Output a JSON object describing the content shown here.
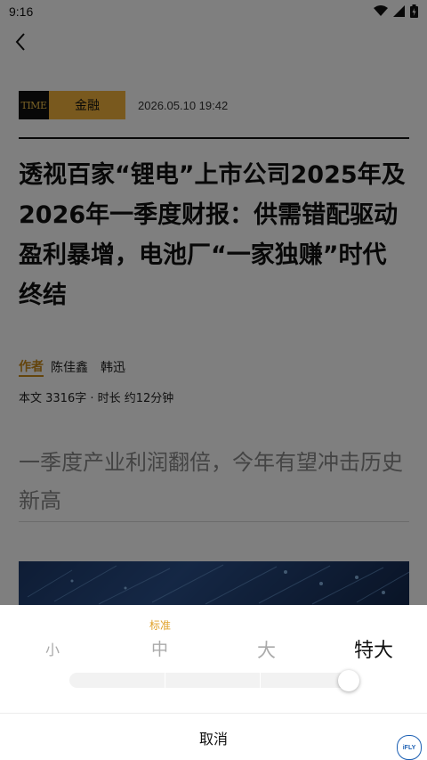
{
  "status_bar": {
    "time": "9:16"
  },
  "article": {
    "logo_text": "TIME",
    "channel": "金融",
    "datetime": "2026.05.10 19:42",
    "title": "透视百家“锂电”上市公司2025年及2026年一季度财报：供需错配驱动盈利暴增，电池厂“一家独赚”时代终结",
    "author_label": "作者",
    "authors": [
      "陈佳鑫",
      "韩迅"
    ],
    "meta": "本文 3316字 · 时长 约12分钟",
    "subtitle": "一季度产业利润翻倍，今年有望冲击历史新高"
  },
  "font_sheet": {
    "hint": "标准",
    "sizes": [
      "小",
      "中",
      "大",
      "特大"
    ],
    "selected_index": 3,
    "cancel_label": "取消"
  },
  "badge": {
    "text": "iFLY"
  },
  "colors": {
    "accent": "#f3b33c",
    "author_tag": "#c98a1a",
    "hint": "#e0a12a"
  }
}
